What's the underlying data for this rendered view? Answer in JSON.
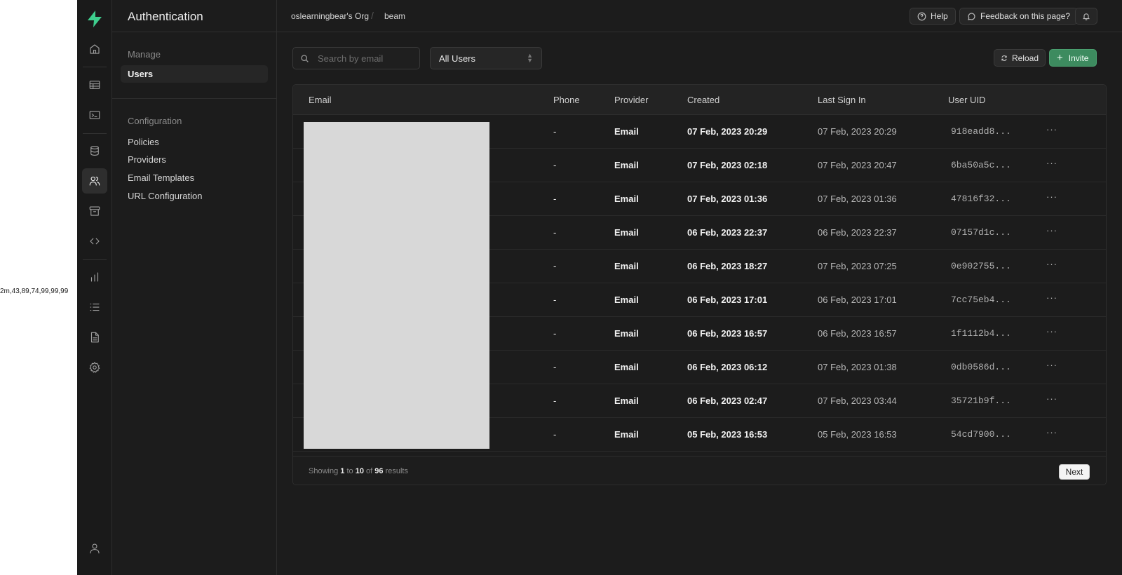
{
  "outside": {
    "text": "2m,43,89,74,99,99,99"
  },
  "rail": {
    "items": [
      {
        "icon": "home-icon"
      },
      {
        "icon": "table-icon"
      },
      {
        "icon": "terminal-icon"
      },
      {
        "icon": "database-icon"
      },
      {
        "icon": "users-icon",
        "active": true
      },
      {
        "icon": "archive-icon"
      },
      {
        "icon": "code-icon"
      },
      {
        "icon": "bar-chart-icon"
      },
      {
        "icon": "list-icon"
      },
      {
        "icon": "document-icon"
      },
      {
        "icon": "gear-icon"
      },
      {
        "icon": "user-icon"
      }
    ]
  },
  "sidebar": {
    "title": "Authentication",
    "groups": [
      {
        "label": "Manage",
        "items": [
          "Users"
        ]
      },
      {
        "label": "Configuration",
        "items": [
          "Policies",
          "Providers",
          "Email Templates",
          "URL Configuration"
        ]
      }
    ],
    "active_item": "Users"
  },
  "topbar": {
    "breadcrumb": [
      "oslearningbear's Org",
      "beam"
    ],
    "separator": "/",
    "help": "Help",
    "feedback": "Feedback on this page?"
  },
  "toolbar": {
    "search_placeholder": "Search by email",
    "filter_value": "All Users",
    "reload": "Reload",
    "invite": "Invite"
  },
  "table": {
    "columns": [
      "Email",
      "Phone",
      "Provider",
      "Created",
      "Last Sign In",
      "User UID"
    ],
    "rows": [
      {
        "phone": "-",
        "provider": "Email",
        "created": "07 Feb, 2023 20:29",
        "last": "07 Feb, 2023 20:29",
        "uid": "918eadd8..."
      },
      {
        "phone": "-",
        "provider": "Email",
        "created": "07 Feb, 2023 02:18",
        "last": "07 Feb, 2023 20:47",
        "uid": "6ba50a5c..."
      },
      {
        "phone": "-",
        "provider": "Email",
        "created": "07 Feb, 2023 01:36",
        "last": "07 Feb, 2023 01:36",
        "uid": "47816f32..."
      },
      {
        "phone": "-",
        "provider": "Email",
        "created": "06 Feb, 2023 22:37",
        "last": "06 Feb, 2023 22:37",
        "uid": "07157d1c..."
      },
      {
        "phone": "-",
        "provider": "Email",
        "created": "06 Feb, 2023 18:27",
        "last": "07 Feb, 2023 07:25",
        "uid": "0e902755..."
      },
      {
        "phone": "-",
        "provider": "Email",
        "created": "06 Feb, 2023 17:01",
        "last": "06 Feb, 2023 17:01",
        "uid": "7cc75eb4..."
      },
      {
        "phone": "-",
        "provider": "Email",
        "created": "06 Feb, 2023 16:57",
        "last": "06 Feb, 2023 16:57",
        "uid": "1f1112b4..."
      },
      {
        "phone": "-",
        "provider": "Email",
        "created": "06 Feb, 2023 06:12",
        "last": "07 Feb, 2023 01:38",
        "uid": "0db0586d..."
      },
      {
        "phone": "-",
        "provider": "Email",
        "created": "06 Feb, 2023 02:47",
        "last": "07 Feb, 2023 03:44",
        "uid": "35721b9f..."
      },
      {
        "phone": "-",
        "provider": "Email",
        "created": "05 Feb, 2023 16:53",
        "last": "05 Feb, 2023 16:53",
        "uid": "54cd7900..."
      }
    ],
    "more_label": "···"
  },
  "pagination": {
    "showing": "Showing",
    "from": "1",
    "to_word": "to",
    "to": "10",
    "of_word": "of",
    "total": "96",
    "results": "results",
    "next": "Next"
  },
  "colors": {
    "accent": "#3ecf8e",
    "invite_bg": "#3d8b5f",
    "bg": "#1c1c1c"
  }
}
